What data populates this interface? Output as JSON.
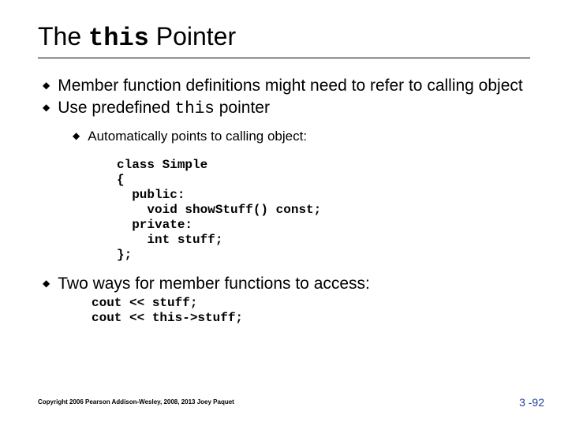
{
  "title": {
    "pre": "The ",
    "kw": "this",
    "post": " Pointer"
  },
  "bullets1": {
    "a": "Member function definitions might need to refer to calling object",
    "b_pre": "Use predefined ",
    "b_kw": "this",
    "b_post": " pointer"
  },
  "subbullet": "Automatically points to calling object:",
  "code1": "class Simple\n{\n  public:\n    void showStuff() const;\n  private:\n    int stuff;\n};",
  "bullet2": "Two ways for member functions to access:",
  "code2": "cout << stuff;\ncout << this->stuff;",
  "copyright": "Copyright 2006 Pearson Addison-Wesley, 2008, 2013 Joey Paquet",
  "pagenum": "3 -92"
}
